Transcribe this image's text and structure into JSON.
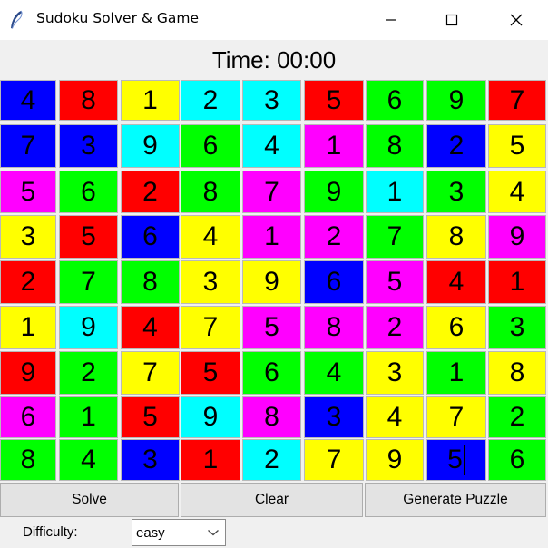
{
  "window": {
    "title": "Sudoku Solver & Game",
    "icon": "feather-icon"
  },
  "timer": {
    "text": "Time: 00:00"
  },
  "board": {
    "colors": {
      "B": "#0000ff",
      "R": "#ff0000",
      "Y": "#ffff00",
      "C": "#00ffff",
      "G": "#00ff00",
      "M": "#ff00ff"
    },
    "rows": [
      [
        {
          "v": "4",
          "c": "B"
        },
        {
          "v": "8",
          "c": "R"
        },
        {
          "v": "1",
          "c": "Y"
        },
        {
          "v": "2",
          "c": "C"
        },
        {
          "v": "3",
          "c": "C"
        },
        {
          "v": "5",
          "c": "R"
        },
        {
          "v": "6",
          "c": "G"
        },
        {
          "v": "9",
          "c": "G"
        },
        {
          "v": "7",
          "c": "R"
        }
      ],
      [
        {
          "v": "7",
          "c": "B"
        },
        {
          "v": "3",
          "c": "B"
        },
        {
          "v": "9",
          "c": "C"
        },
        {
          "v": "6",
          "c": "G"
        },
        {
          "v": "4",
          "c": "C"
        },
        {
          "v": "1",
          "c": "M"
        },
        {
          "v": "8",
          "c": "G"
        },
        {
          "v": "2",
          "c": "B"
        },
        {
          "v": "5",
          "c": "Y"
        }
      ],
      [
        {
          "v": "5",
          "c": "M"
        },
        {
          "v": "6",
          "c": "G"
        },
        {
          "v": "2",
          "c": "R"
        },
        {
          "v": "8",
          "c": "G"
        },
        {
          "v": "7",
          "c": "M"
        },
        {
          "v": "9",
          "c": "G"
        },
        {
          "v": "1",
          "c": "C"
        },
        {
          "v": "3",
          "c": "G"
        },
        {
          "v": "4",
          "c": "Y"
        }
      ],
      [
        {
          "v": "3",
          "c": "Y"
        },
        {
          "v": "5",
          "c": "R"
        },
        {
          "v": "6",
          "c": "B"
        },
        {
          "v": "4",
          "c": "Y"
        },
        {
          "v": "1",
          "c": "M"
        },
        {
          "v": "2",
          "c": "M"
        },
        {
          "v": "7",
          "c": "G"
        },
        {
          "v": "8",
          "c": "Y"
        },
        {
          "v": "9",
          "c": "M"
        }
      ],
      [
        {
          "v": "2",
          "c": "R"
        },
        {
          "v": "7",
          "c": "G"
        },
        {
          "v": "8",
          "c": "G"
        },
        {
          "v": "3",
          "c": "Y"
        },
        {
          "v": "9",
          "c": "Y"
        },
        {
          "v": "6",
          "c": "B"
        },
        {
          "v": "5",
          "c": "M"
        },
        {
          "v": "4",
          "c": "R"
        },
        {
          "v": "1",
          "c": "R"
        }
      ],
      [
        {
          "v": "1",
          "c": "Y"
        },
        {
          "v": "9",
          "c": "C"
        },
        {
          "v": "4",
          "c": "R"
        },
        {
          "v": "7",
          "c": "Y"
        },
        {
          "v": "5",
          "c": "M"
        },
        {
          "v": "8",
          "c": "M"
        },
        {
          "v": "2",
          "c": "M"
        },
        {
          "v": "6",
          "c": "Y"
        },
        {
          "v": "3",
          "c": "G"
        }
      ],
      [
        {
          "v": "9",
          "c": "R"
        },
        {
          "v": "2",
          "c": "G"
        },
        {
          "v": "7",
          "c": "Y"
        },
        {
          "v": "5",
          "c": "R"
        },
        {
          "v": "6",
          "c": "G"
        },
        {
          "v": "4",
          "c": "G"
        },
        {
          "v": "3",
          "c": "Y"
        },
        {
          "v": "1",
          "c": "G"
        },
        {
          "v": "8",
          "c": "Y"
        }
      ],
      [
        {
          "v": "6",
          "c": "M"
        },
        {
          "v": "1",
          "c": "G"
        },
        {
          "v": "5",
          "c": "R"
        },
        {
          "v": "9",
          "c": "C"
        },
        {
          "v": "8",
          "c": "M"
        },
        {
          "v": "3",
          "c": "B"
        },
        {
          "v": "4",
          "c": "Y"
        },
        {
          "v": "7",
          "c": "Y"
        },
        {
          "v": "2",
          "c": "G"
        }
      ],
      [
        {
          "v": "8",
          "c": "G"
        },
        {
          "v": "4",
          "c": "G"
        },
        {
          "v": "3",
          "c": "B"
        },
        {
          "v": "1",
          "c": "R"
        },
        {
          "v": "2",
          "c": "C"
        },
        {
          "v": "7",
          "c": "Y"
        },
        {
          "v": "9",
          "c": "Y"
        },
        {
          "v": "5",
          "c": "B",
          "cursor": true
        },
        {
          "v": "6",
          "c": "G"
        }
      ]
    ]
  },
  "actions": {
    "solve": "Solve",
    "clear": "Clear",
    "generate": "Generate Puzzle"
  },
  "difficulty": {
    "label": "Difficulty:",
    "selected": "easy"
  }
}
